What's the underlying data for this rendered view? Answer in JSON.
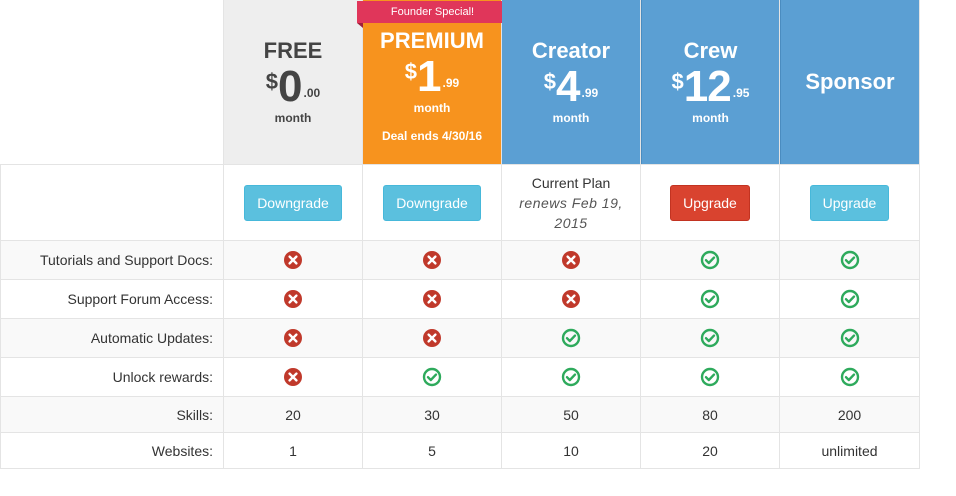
{
  "plans": [
    {
      "name": "FREE",
      "currency": "$",
      "price_whole": "0",
      "price_cents": ".00",
      "period": "month",
      "button": "Downgrade"
    },
    {
      "name": "PREMIUM",
      "ribbon": "Founder Special!",
      "currency": "$",
      "price_whole": "1",
      "price_cents": ".99",
      "period": "month",
      "deal": "Deal ends 4/30/16",
      "button": "Downgrade"
    },
    {
      "name": "Creator",
      "currency": "$",
      "price_whole": "4",
      "price_cents": ".99",
      "period": "month",
      "current_label": "Current Plan",
      "renews": "renews Feb 19, 2015"
    },
    {
      "name": "Crew",
      "currency": "$",
      "price_whole": "12",
      "price_cents": ".95",
      "period": "month",
      "button": "Upgrade"
    },
    {
      "name": "Sponsor",
      "button": "Upgrade"
    }
  ],
  "features": [
    {
      "label": "Tutorials and Support Docs:",
      "values": [
        "no",
        "no",
        "no",
        "yes",
        "yes"
      ]
    },
    {
      "label": "Support Forum Access:",
      "values": [
        "no",
        "no",
        "no",
        "yes",
        "yes"
      ]
    },
    {
      "label": "Automatic Updates:",
      "values": [
        "no",
        "no",
        "yes",
        "yes",
        "yes"
      ]
    },
    {
      "label": "Unlock rewards:",
      "values": [
        "no",
        "yes",
        "yes",
        "yes",
        "yes"
      ]
    }
  ],
  "skills": {
    "label": "Skills:",
    "values": [
      "20",
      "30",
      "50",
      "80",
      "200"
    ]
  },
  "websites": {
    "label": "Websites:",
    "values": [
      "1",
      "5",
      "10",
      "20",
      "unlimited"
    ]
  },
  "colors": {
    "free_bg": "#eeeeee",
    "premium_bg": "#f7931e",
    "blue_bg": "#5b9fd3",
    "ribbon": "#e0365a",
    "info_btn": "#5bc0de",
    "danger_btn": "#d9432f",
    "check": "#2eaa5c",
    "cross": "#c0392b"
  },
  "icons": {
    "yes": "check-circle-icon",
    "no": "x-circle-icon"
  }
}
